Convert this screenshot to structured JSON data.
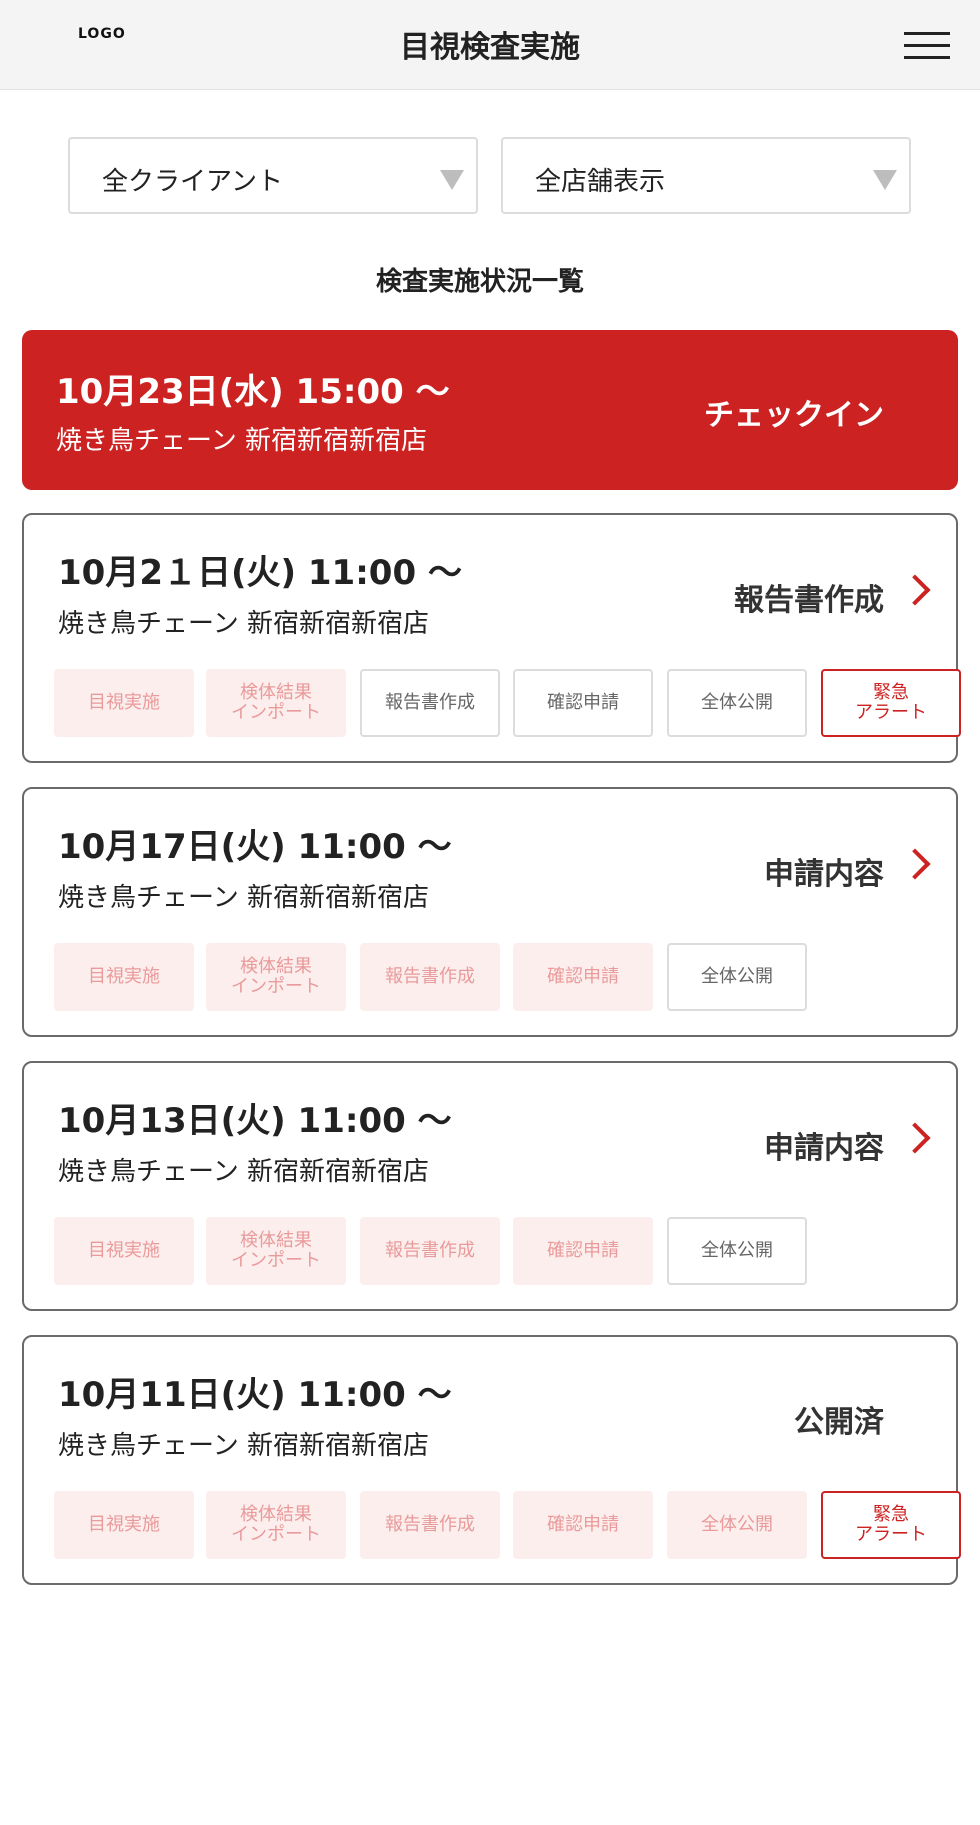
{
  "header": {
    "logo_text": "LOGO",
    "title": "目視検査実施"
  },
  "filters": {
    "client": "全クライアント",
    "store": "全店舗表示"
  },
  "section_title": "検査実施状況一覧",
  "cards": [
    {
      "date": "10月23日(水)  15:00 〜",
      "store": "焼き鳥チェーン  新宿新宿新宿店",
      "action": "チェックイン"
    },
    {
      "date": "10月2１日(火)  11:00 〜",
      "store": "焼き鳥チェーン  新宿新宿新宿店",
      "action": "報告書作成",
      "steps": [
        "目視実施",
        "検体結果",
        "インポート",
        "報告書作成",
        "確認申請",
        "全体公開"
      ],
      "alert": [
        "緊急",
        "アラート"
      ]
    },
    {
      "date": "10月17日(火)  11:00 〜",
      "store": "焼き鳥チェーン  新宿新宿新宿店",
      "action": "申請内容",
      "steps": [
        "目視実施",
        "検体結果",
        "インポート",
        "報告書作成",
        "確認申請",
        "全体公開"
      ]
    },
    {
      "date": "10月13日(火)  11:00 〜",
      "store": "焼き鳥チェーン  新宿新宿新宿店",
      "action": "申請内容",
      "steps": [
        "目視実施",
        "検体結果",
        "インポート",
        "報告書作成",
        "確認申請",
        "全体公開"
      ]
    },
    {
      "date": "10月11日(火)  11:00 〜",
      "store": "焼き鳥チェーン  新宿新宿新宿店",
      "action": "公開済",
      "steps": [
        "目視実施",
        "検体結果",
        "インポート",
        "報告書作成",
        "確認申請",
        "全体公開"
      ],
      "alert": [
        "緊急",
        "アラート"
      ]
    }
  ],
  "colors": {
    "accent": "#cc2222",
    "done_bg": "#fdeeee",
    "done_text": "#e99a9a"
  }
}
